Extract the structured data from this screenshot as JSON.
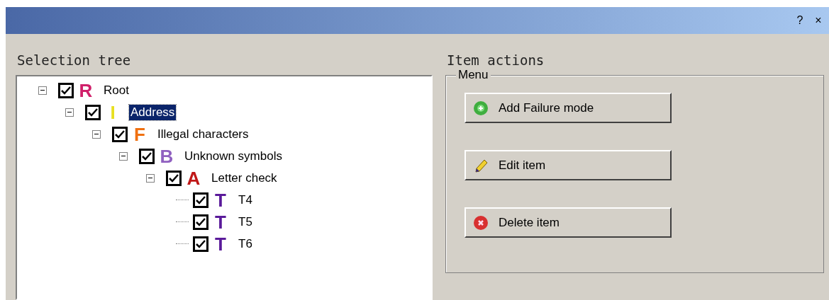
{
  "title_buttons": [
    {
      "kind": "help",
      "label": "?"
    },
    {
      "kind": "close",
      "label": "×"
    }
  ],
  "selection_tree": {
    "heading": "Selection tree",
    "nodes": [
      {
        "label": "Root",
        "icon_letter": "R",
        "color": "#d0206a",
        "checked": true,
        "expanded": true,
        "selected": false,
        "children": [
          {
            "label": "Address",
            "icon_letter": "I",
            "color": "#e8e020",
            "checked": true,
            "expanded": true,
            "selected": true,
            "children": [
              {
                "label": "Illegal characters",
                "icon_letter": "F",
                "color": "#f07010",
                "checked": true,
                "expanded": true,
                "selected": false,
                "children": [
                  {
                    "label": "Unknown symbols",
                    "icon_letter": "B",
                    "color": "#9060c0",
                    "checked": true,
                    "expanded": true,
                    "selected": false,
                    "children": [
                      {
                        "label": "Letter check",
                        "icon_letter": "A",
                        "color": "#c01818",
                        "checked": true,
                        "expanded": true,
                        "selected": false,
                        "children": [
                          {
                            "label": "T4",
                            "icon_letter": "T",
                            "color": "#5a1a9a",
                            "checked": true,
                            "selected": false
                          },
                          {
                            "label": "T5",
                            "icon_letter": "T",
                            "color": "#5a1a9a",
                            "checked": true,
                            "selected": false
                          },
                          {
                            "label": "T6",
                            "icon_letter": "T",
                            "color": "#5a1a9a",
                            "checked": true,
                            "selected": false
                          }
                        ]
                      }
                    ]
                  }
                ]
              }
            ]
          }
        ]
      }
    ]
  },
  "item_actions": {
    "heading": "Item actions",
    "group_label": "Menu",
    "buttons": [
      {
        "kind": "add",
        "label": "Add Failure mode"
      },
      {
        "kind": "edit",
        "label": "Edit item"
      },
      {
        "kind": "delete",
        "label": "Delete item"
      }
    ]
  }
}
